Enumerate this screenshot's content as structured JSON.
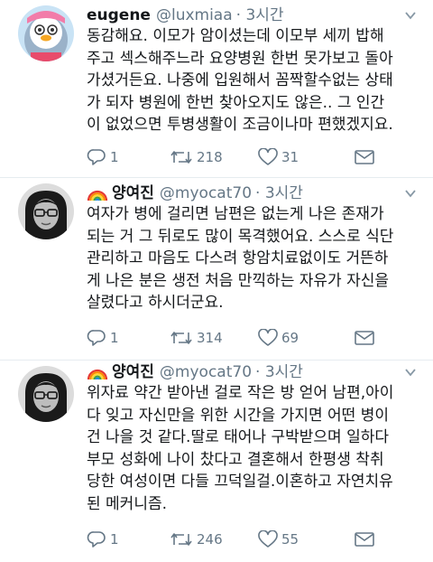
{
  "tweets": [
    {
      "name": "eugene",
      "handle": "@luxmiaa",
      "time": "· 3시간",
      "has_rainbow": false,
      "avatar_icon": "penguin-avatar-icon",
      "lines": [
        "동감해요. 이모가 암이셨는데 이모부 세끼 밥해",
        "주고 섹스해주느라 요양병원 한번 못가보고 돌아",
        "가셨거든요. 나중에 입원해서 꼼짝할수없는 상태",
        "가 되자 병원에 한번 찾아오지도 않은.. 그 인간",
        "이 없었으면 투병생활이 조금이나마 편했겠지요."
      ],
      "replies": "1",
      "retweets": "218",
      "likes": "31"
    },
    {
      "name": "양여진",
      "handle": "@myocat70",
      "time": "· 3시간",
      "has_rainbow": true,
      "avatar_icon": "woman-glasses-avatar-icon",
      "lines": [
        "여자가 병에 걸리면 남편은 없는게 나은 존재가",
        "되는 거 그 뒤로도 많이 목격했어요. 스스로 식단",
        "관리하고 마음도 다스려 항암치료없이도 거뜬하",
        "게 나은 분은 생전 처음 만끽하는 자유가 자신을",
        "살렸다고 하시더군요."
      ],
      "replies": "1",
      "retweets": "314",
      "likes": "69"
    },
    {
      "name": "양여진",
      "handle": "@myocat70",
      "time": "· 3시간",
      "has_rainbow": true,
      "avatar_icon": "woman-glasses-avatar-icon",
      "lines": [
        "위자료 약간 받아낸 걸로 작은 방 얻어 남편,아이",
        "다 잊고 자신만을 위한 시간을 가지면 어떤 병이",
        "건 나을 것 같다.딸로 태어나 구박받으며 일하다",
        "부모 성화에 나이 찼다고 결혼해서 한평생 착취",
        "당한 여성이면 다들 끄덕일걸.이혼하고 자연치유",
        "된 메커니즘."
      ],
      "replies": "1",
      "retweets": "246",
      "likes": "55"
    }
  ],
  "colors": {
    "text": "#14171a",
    "muted": "#657786",
    "separator": "#e6ecf0"
  }
}
